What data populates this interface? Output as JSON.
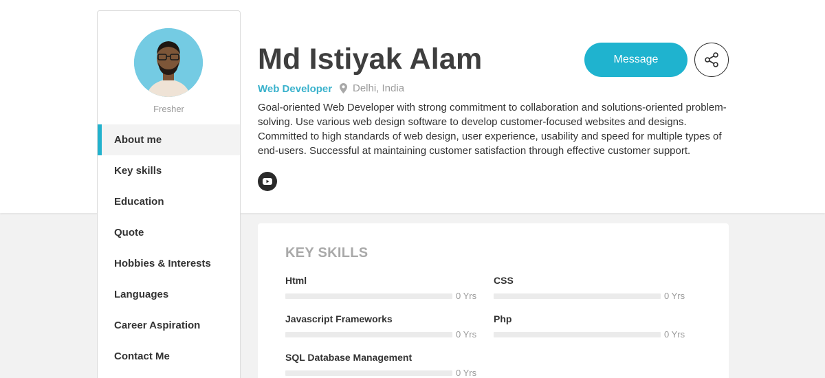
{
  "profile": {
    "name": "Md Istiyak Alam",
    "role": "Web Developer",
    "location": "Delhi, India",
    "status": "Fresher",
    "bio": "Goal-oriented Web Developer with strong commitment to collaboration and solutions-oriented problem-solving. Use various web design software to develop customer-focused websites and designs. Committed to high standards of web design, user experience, usability and speed for multiple types of end-users. Successful at maintaining customer satisfaction through effective customer support."
  },
  "actions": {
    "message_label": "Message"
  },
  "sidebar": {
    "items": [
      {
        "label": "About me",
        "active": true
      },
      {
        "label": "Key skills"
      },
      {
        "label": "Education"
      },
      {
        "label": "Quote"
      },
      {
        "label": "Hobbies & Interests"
      },
      {
        "label": "Languages"
      },
      {
        "label": "Career Aspiration"
      },
      {
        "label": "Contact Me"
      }
    ]
  },
  "key_skills": {
    "title": "KEY SKILLS",
    "skills": [
      {
        "name": "Html",
        "years": "0 Yrs",
        "level": 0
      },
      {
        "name": "CSS",
        "years": "0 Yrs",
        "level": 0
      },
      {
        "name": "Javascript Frameworks",
        "years": "0 Yrs",
        "level": 0
      },
      {
        "name": "Php",
        "years": "0 Yrs",
        "level": 0
      },
      {
        "name": "SQL Database Management",
        "years": "0 Yrs",
        "level": 0
      }
    ]
  },
  "icons": {
    "location": "map-pin-icon",
    "youtube": "youtube-icon",
    "share": "share-icon"
  },
  "colors": {
    "accent": "#1fb3cf",
    "role_text": "#3ab2cc"
  }
}
